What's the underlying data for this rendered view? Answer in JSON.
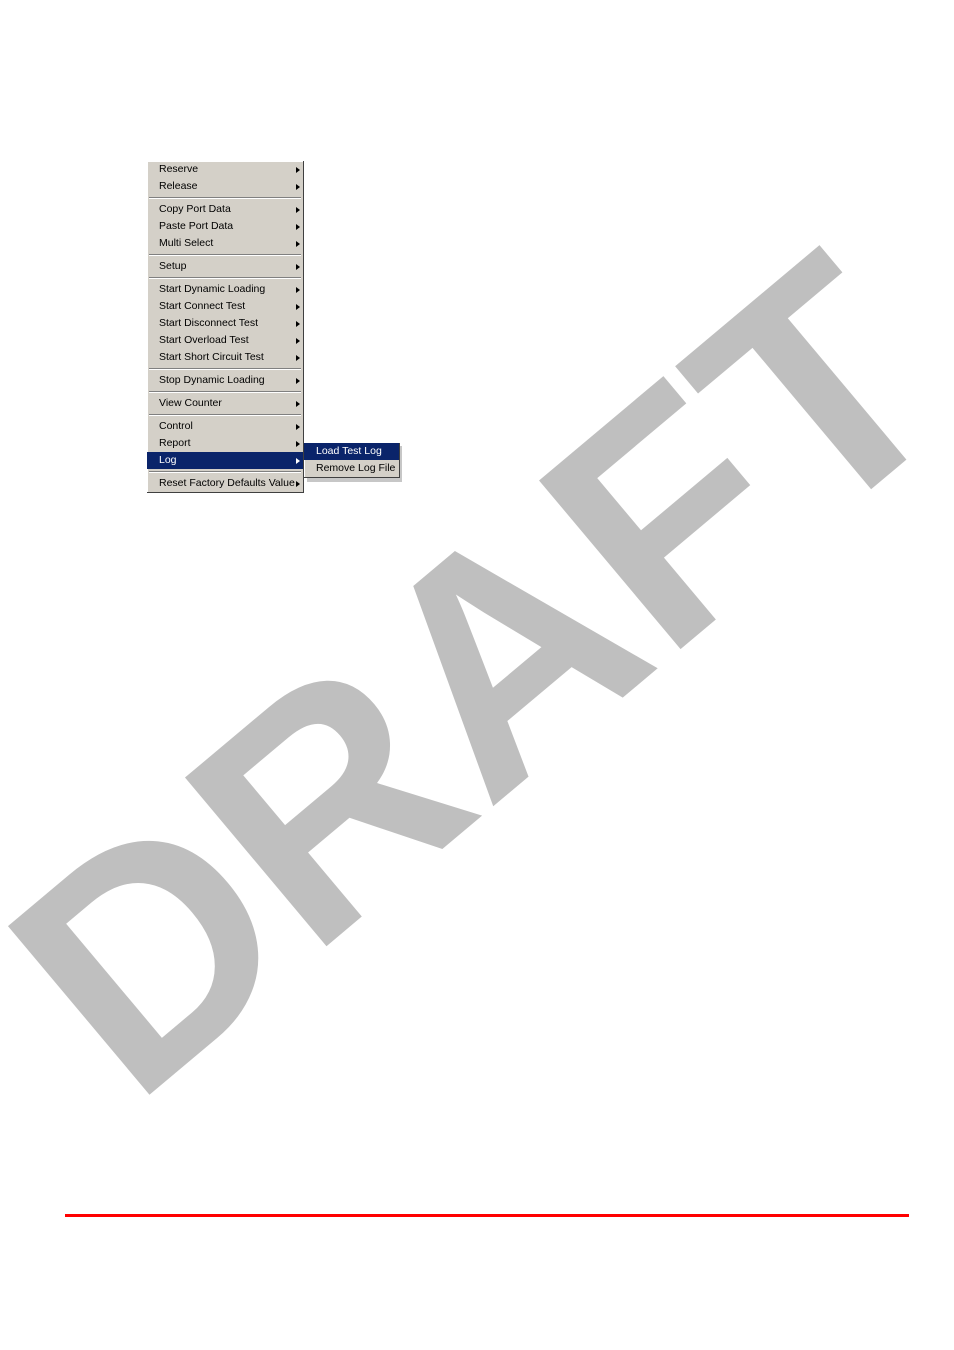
{
  "watermark": "DRAFT",
  "menu": {
    "groups": [
      {
        "items": [
          {
            "label": "Reserve",
            "has_submenu": true
          },
          {
            "label": "Release",
            "has_submenu": true
          }
        ]
      },
      {
        "items": [
          {
            "label": "Copy Port Data",
            "has_submenu": true
          },
          {
            "label": "Paste Port Data",
            "has_submenu": true
          },
          {
            "label": "Multi Select",
            "has_submenu": true
          }
        ]
      },
      {
        "items": [
          {
            "label": "Setup",
            "has_submenu": true
          }
        ]
      },
      {
        "items": [
          {
            "label": "Start Dynamic Loading",
            "has_submenu": true
          },
          {
            "label": "Start Connect Test",
            "has_submenu": true
          },
          {
            "label": "Start Disconnect Test",
            "has_submenu": true
          },
          {
            "label": "Start Overload Test",
            "has_submenu": true
          },
          {
            "label": "Start Short Circuit Test",
            "has_submenu": true
          }
        ]
      },
      {
        "items": [
          {
            "label": "Stop Dynamic Loading",
            "has_submenu": true
          }
        ]
      },
      {
        "items": [
          {
            "label": "View Counter",
            "has_submenu": true
          }
        ]
      },
      {
        "items": [
          {
            "label": "Control",
            "has_submenu": true
          },
          {
            "label": "Report",
            "has_submenu": true
          },
          {
            "label": "Log",
            "has_submenu": true,
            "highlight": true
          }
        ]
      },
      {
        "items": [
          {
            "label": "Reset Factory Defaults Value",
            "has_submenu": true
          }
        ]
      }
    ]
  },
  "submenu": {
    "items": [
      {
        "label": "Load Test Log",
        "highlight": true
      },
      {
        "label": "Remove Log File",
        "highlight": false
      }
    ]
  },
  "colors": {
    "menu_bg": "#d4d0c8",
    "highlight_bg": "#0a246a",
    "highlight_fg": "#ffffff",
    "footer_line": "#ff0000",
    "watermark": "#bfbfbf"
  }
}
